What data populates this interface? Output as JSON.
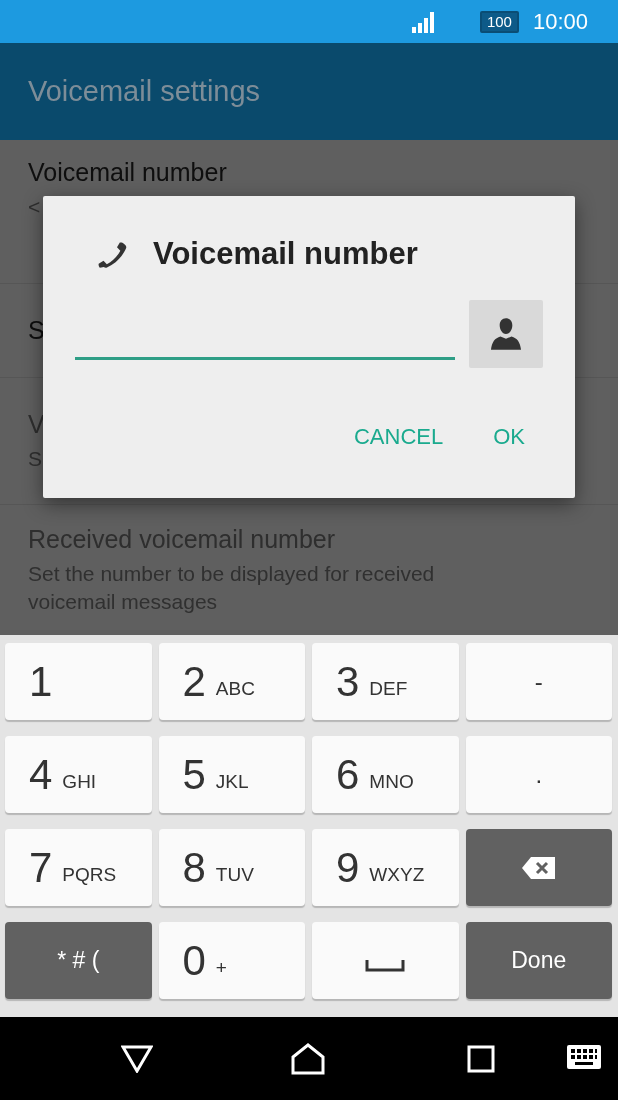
{
  "status_bar": {
    "battery": "100",
    "time": "10:00"
  },
  "app_bar": {
    "title": "Voicemail settings"
  },
  "settings": [
    {
      "title": "Voicemail number",
      "subtitle": "<",
      "disabled": false
    },
    {
      "title": "S",
      "disabled": false
    },
    {
      "title": "V",
      "subtitle": "S",
      "disabled": true
    },
    {
      "title": "Received voicemail number",
      "subtitle": "Set the number to be displayed for received voicemail messages",
      "disabled": true
    }
  ],
  "dialog": {
    "title": "Voicemail number",
    "buttons": [
      "CANCEL",
      "OK"
    ]
  },
  "keyboard": [
    {
      "label": "1",
      "kind": "digit"
    },
    {
      "label": "2",
      "sub": "ABC",
      "kind": "digit"
    },
    {
      "label": "3",
      "sub": "DEF",
      "kind": "digit"
    },
    {
      "label": "-",
      "kind": "symbol"
    },
    {
      "label": "4",
      "sub": "GHI",
      "kind": "digit"
    },
    {
      "label": "5",
      "sub": "JKL",
      "kind": "digit"
    },
    {
      "label": "6",
      "sub": "MNO",
      "kind": "digit"
    },
    {
      "label": ".",
      "kind": "symbol"
    },
    {
      "label": "7",
      "sub": "PQRS",
      "kind": "digit"
    },
    {
      "label": "8",
      "sub": "TUV",
      "kind": "digit"
    },
    {
      "label": "9",
      "sub": "WXYZ",
      "kind": "digit"
    },
    {
      "kind": "backspace"
    },
    {
      "label": "* # (",
      "kind": "function"
    },
    {
      "label": "0",
      "sub": "+",
      "kind": "digit"
    },
    {
      "kind": "space"
    },
    {
      "label": "Done",
      "kind": "function"
    }
  ]
}
